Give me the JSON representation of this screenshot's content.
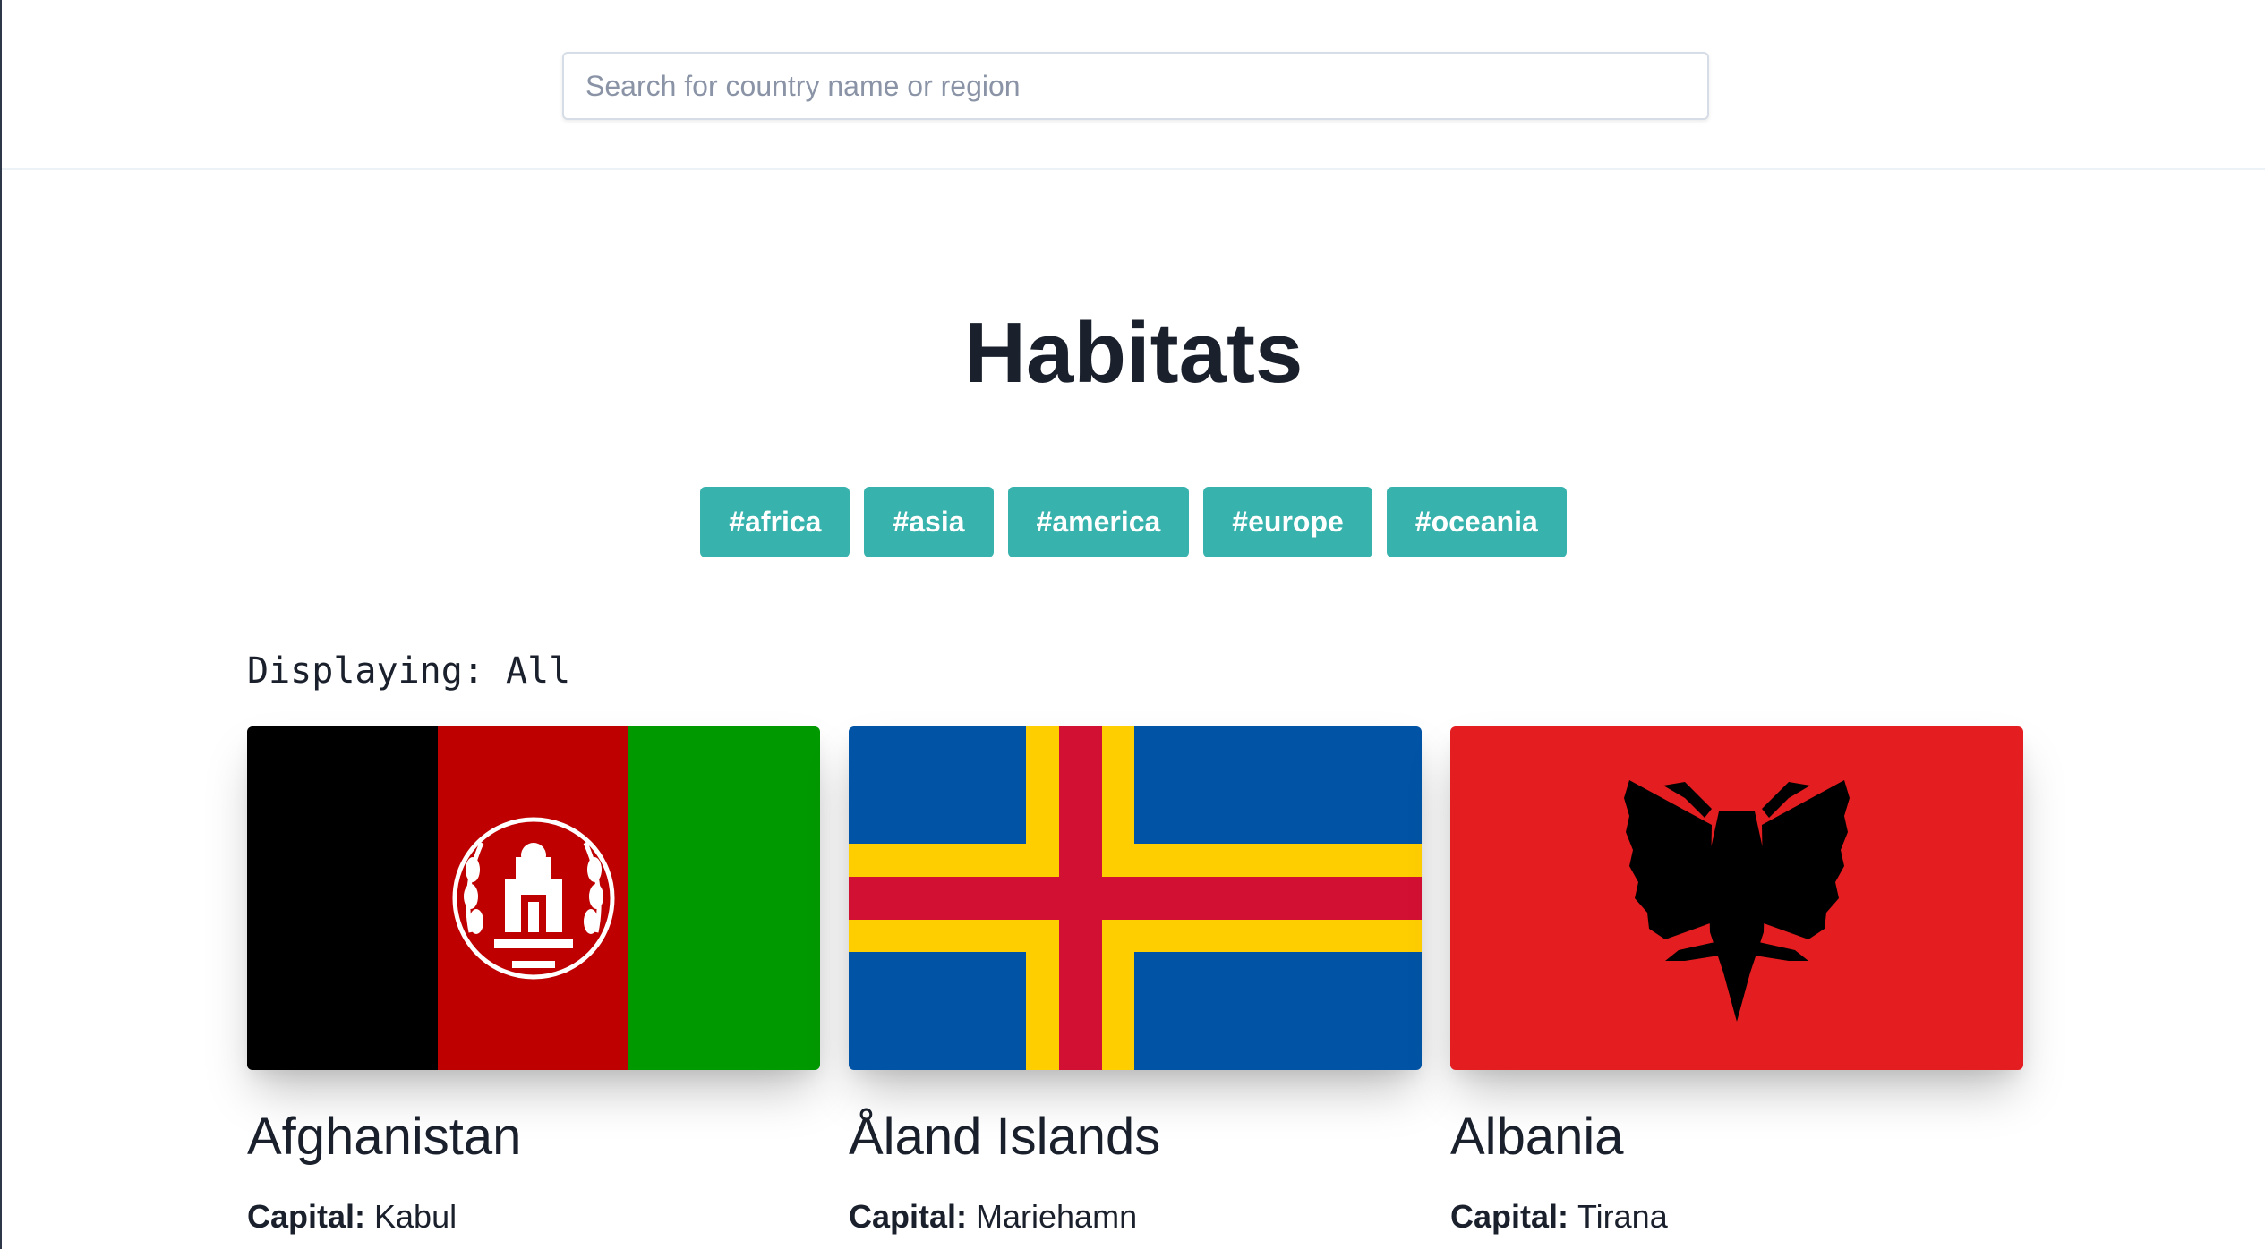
{
  "search": {
    "placeholder": "Search for country name or region",
    "value": ""
  },
  "heading": "Habitats",
  "tags": [
    "#africa",
    "#asia",
    "#america",
    "#europe",
    "#oceania"
  ],
  "display": {
    "text": "Displaying: All"
  },
  "colors": {
    "tag_bg": "#38b2ac",
    "text": "#1a202c"
  },
  "countries": [
    {
      "name": "Afghanistan",
      "capital_label": "Capital:",
      "capital": "Kabul",
      "flag_icon": "afghanistan-flag"
    },
    {
      "name": "Åland Islands",
      "capital_label": "Capital:",
      "capital": "Mariehamn",
      "flag_icon": "aland-islands-flag"
    },
    {
      "name": "Albania",
      "capital_label": "Capital:",
      "capital": "Tirana",
      "flag_icon": "albania-flag"
    }
  ]
}
